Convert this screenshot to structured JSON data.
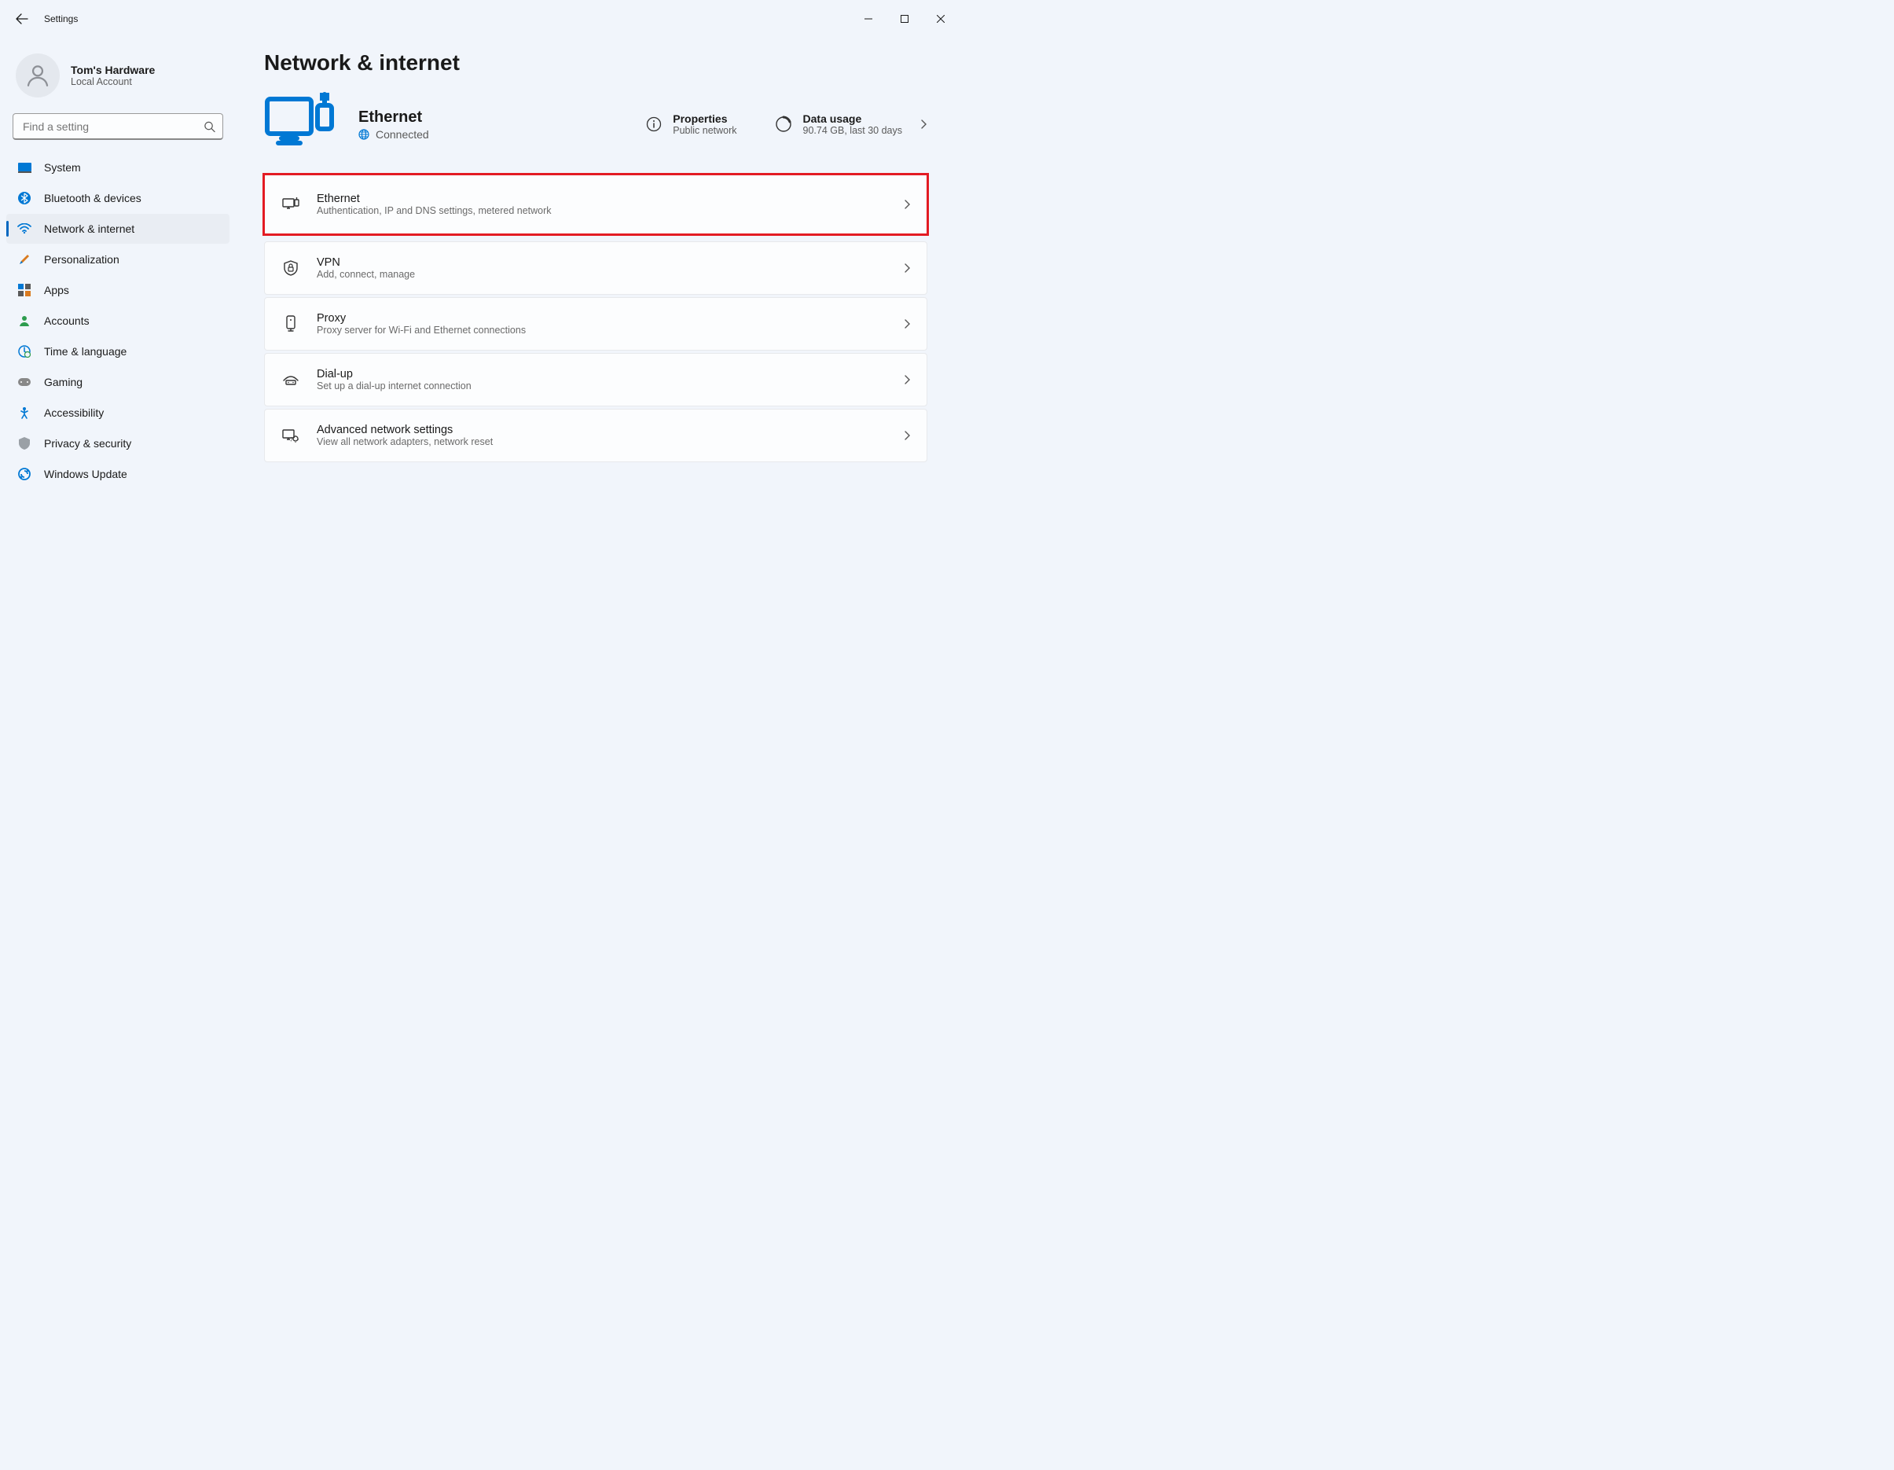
{
  "app_title": "Settings",
  "profile": {
    "name": "Tom's Hardware",
    "sub": "Local Account"
  },
  "search": {
    "placeholder": "Find a setting"
  },
  "sidebar": {
    "items": [
      {
        "label": "System"
      },
      {
        "label": "Bluetooth & devices"
      },
      {
        "label": "Network & internet"
      },
      {
        "label": "Personalization"
      },
      {
        "label": "Apps"
      },
      {
        "label": "Accounts"
      },
      {
        "label": "Time & language"
      },
      {
        "label": "Gaming"
      },
      {
        "label": "Accessibility"
      },
      {
        "label": "Privacy & security"
      },
      {
        "label": "Windows Update"
      }
    ]
  },
  "page": {
    "title": "Network & internet",
    "status": {
      "name": "Ethernet",
      "state": "Connected",
      "properties": {
        "title": "Properties",
        "desc": "Public network"
      },
      "data_usage": {
        "title": "Data usage",
        "desc": "90.74 GB, last 30 days"
      }
    },
    "cards": [
      {
        "title": "Ethernet",
        "desc": "Authentication, IP and DNS settings, metered network"
      },
      {
        "title": "VPN",
        "desc": "Add, connect, manage"
      },
      {
        "title": "Proxy",
        "desc": "Proxy server for Wi-Fi and Ethernet connections"
      },
      {
        "title": "Dial-up",
        "desc": "Set up a dial-up internet connection"
      },
      {
        "title": "Advanced network settings",
        "desc": "View all network adapters, network reset"
      }
    ]
  }
}
